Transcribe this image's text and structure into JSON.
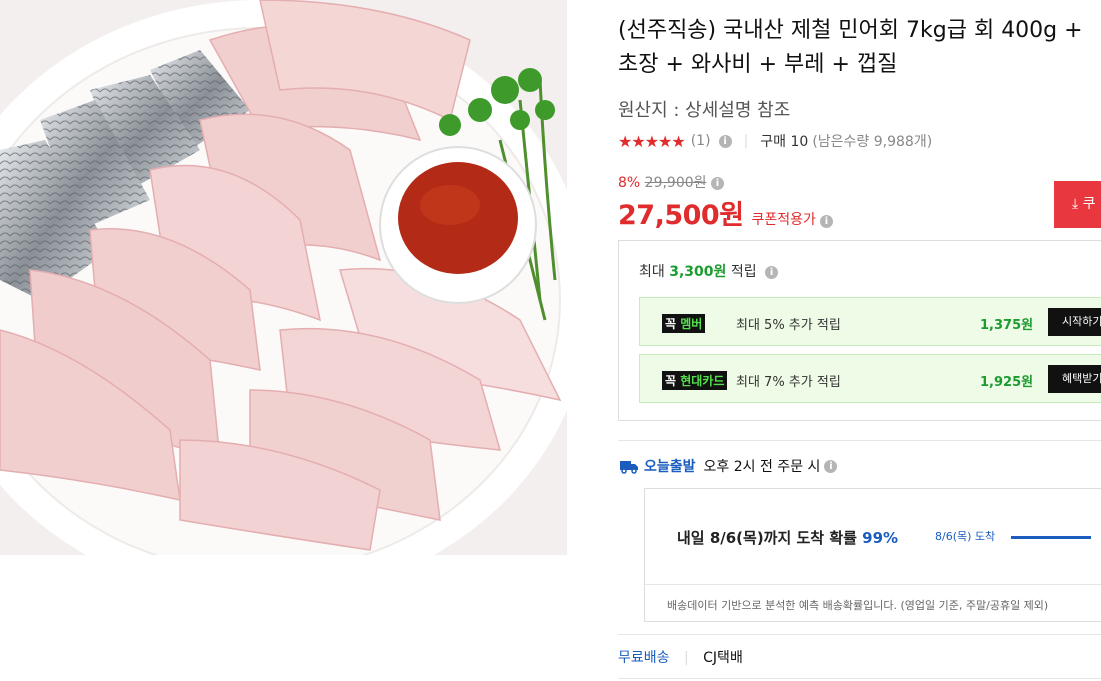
{
  "product": {
    "title": "(선주직송) 국내산 제철 민어회 7kg급 회 400g + 초장 + 와사비 + 부레 + 껍질",
    "origin": "원산지 : 상세설명 참조",
    "rating": {
      "stars": "★★★★★",
      "count": "(1)",
      "purchase": "구매 10",
      "stock": "(남은수량 9,988개)"
    },
    "discount_rate": "8%",
    "original_price": "29,900원",
    "price": "27,500원",
    "coupon_price_label": "쿠폰적용가",
    "coupon_button": "쿠"
  },
  "rewards": {
    "title_prefix": "최대",
    "title_amount": "3,300원",
    "title_suffix": "적립",
    "items": [
      {
        "badge_prefix": "꼭",
        "badge_name": "멤버",
        "text": "최대 5% 추가 적립",
        "amount": "1,375원",
        "button": "시작하기"
      },
      {
        "badge_prefix": "꼭",
        "badge_name": "현대카드",
        "text": "최대 7% 추가 적립",
        "amount": "1,925원",
        "button": "혜택받기"
      }
    ]
  },
  "delivery": {
    "today_label": "오늘출발",
    "today_text": "오후 2시 전 주문 시",
    "arrival_text": "내일 8/6(목)까지 도착 확률",
    "arrival_pct": "99%",
    "arrival_small": "8/6(목) 도착",
    "note": "배송데이터 기반으로 분석한 예측 배송확률입니다. (영업일 기준, 주말/공휴일 제외)"
  },
  "shipping": {
    "fee": "무료배송",
    "carrier": "CJ택배"
  },
  "colors": {
    "price_red": "#e02c2c",
    "green": "#1c9b2f",
    "blue": "#1b5cbf"
  }
}
